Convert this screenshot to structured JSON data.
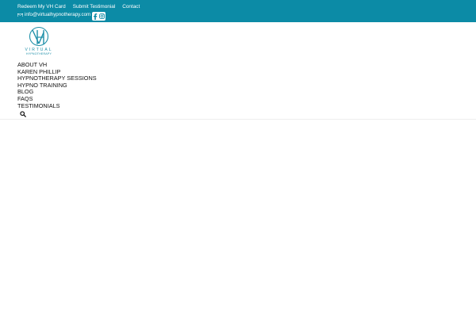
{
  "topbar": {
    "links": [
      "Redeem My VH Card",
      "Submit Testimonial",
      "Contact"
    ],
    "email": "info@virtualhypnotherapy.com",
    "social_icons": [
      "facebook-icon",
      "instagram-icon"
    ]
  },
  "logo": {
    "line1": "VIRTUAL",
    "line2": "HYPNOTHERAPY"
  },
  "nav": {
    "items": [
      "ABOUT VH",
      "KAREN PHILLIP",
      "HYPNOTHERAPY SESSIONS",
      "HYPNO TRAINING",
      "BLOG",
      "FAQS",
      "TESTIMONIALS"
    ]
  },
  "search": {
    "icon": "search-icon"
  },
  "colors": {
    "topbar": "#0c8ba6",
    "brand": "#1d8fa8",
    "text": "#111111"
  }
}
